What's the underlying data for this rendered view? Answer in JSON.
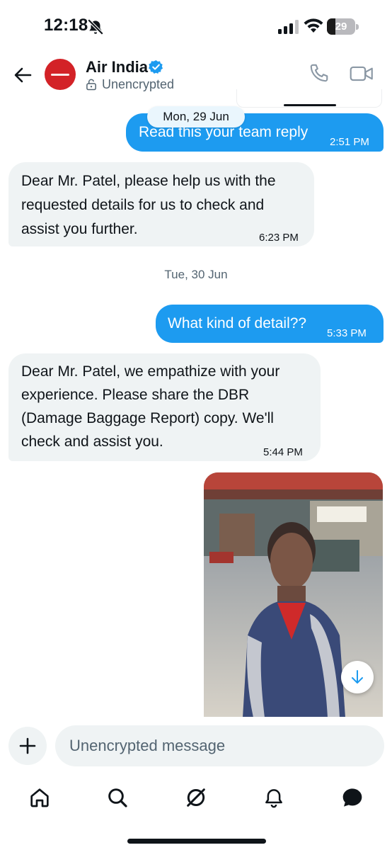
{
  "status_bar": {
    "time": "12:18",
    "battery_level": "29",
    "battery_fraction": 0.29
  },
  "header": {
    "contact_name": "Air India",
    "encryption_status": "Unencrypted",
    "avatar_color": "#d32227",
    "verified_color": "#1d9bf0"
  },
  "messages": [
    {
      "direction": "outgoing",
      "text": "Read this your team reply",
      "time": "2:51 PM"
    },
    {
      "direction": "incoming",
      "lines": [
        "Dear Mr. Patel, please help us with the",
        "requested details for us to check and",
        "assist you further."
      ],
      "time": "6:23 PM"
    },
    {
      "direction": "outgoing",
      "text": "What kind of detail??",
      "time": "5:33 PM"
    },
    {
      "direction": "incoming",
      "lines": [
        "Dear Mr. Patel, we empathize with your",
        "experience. Please share the DBR",
        "(Damage Baggage Report) copy. We'll",
        "check and assist you."
      ],
      "time": "5:44 PM"
    },
    {
      "direction": "outgoing",
      "type": "image",
      "description_icon": "photo-attachment"
    }
  ],
  "date_separators": [
    "Mon, 29 Jun",
    "Tue, 30 Jun"
  ],
  "composer": {
    "placeholder": "Unencrypted message"
  },
  "bottom_nav": [
    "home-icon",
    "search-icon",
    "grok-icon",
    "notifications-icon",
    "messages-icon"
  ],
  "colors": {
    "accent": "#1d9bf0",
    "incoming_bubble": "#eff3f4",
    "secondary_text": "#536471"
  }
}
